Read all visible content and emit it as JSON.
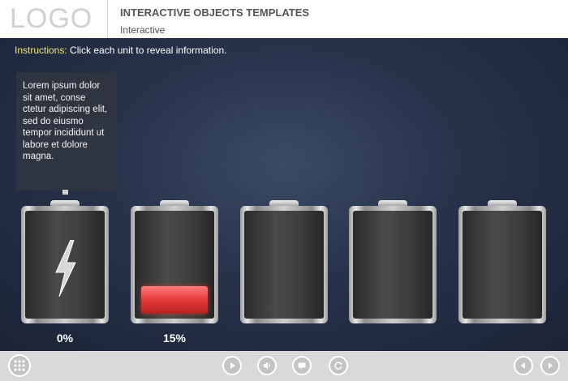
{
  "header": {
    "logo": "LOGO",
    "title": "INTERACTIVE OBJECTS TEMPLATES",
    "subtitle": "Interactive"
  },
  "instructions": {
    "label": "Instructions:",
    "text": " Click each unit to reveal information."
  },
  "tooltip": {
    "text": "Lorem ipsum dolor sit amet, conse ctetur adipiscing elit, sed do eiusmo tempor incididunt ut labore et dolore magna."
  },
  "batteries": [
    {
      "percent_label": "0%",
      "charge": 0,
      "icon": "lightning-bolt-icon"
    },
    {
      "percent_label": "15%",
      "charge": 15
    },
    {
      "percent_label": ""
    },
    {
      "percent_label": ""
    },
    {
      "percent_label": ""
    }
  ],
  "colors": {
    "header_bg": "#ffffff",
    "stage_bg": "#26324a",
    "instructions_label": "#f2e47a",
    "battery_fill": "#e63a3a",
    "footer_bg": "#d9d9d9"
  },
  "footer": {
    "icons": [
      "grid-menu-icon",
      "play-icon",
      "volume-icon",
      "caption-icon",
      "replay-icon",
      "previous-icon",
      "next-icon"
    ]
  }
}
